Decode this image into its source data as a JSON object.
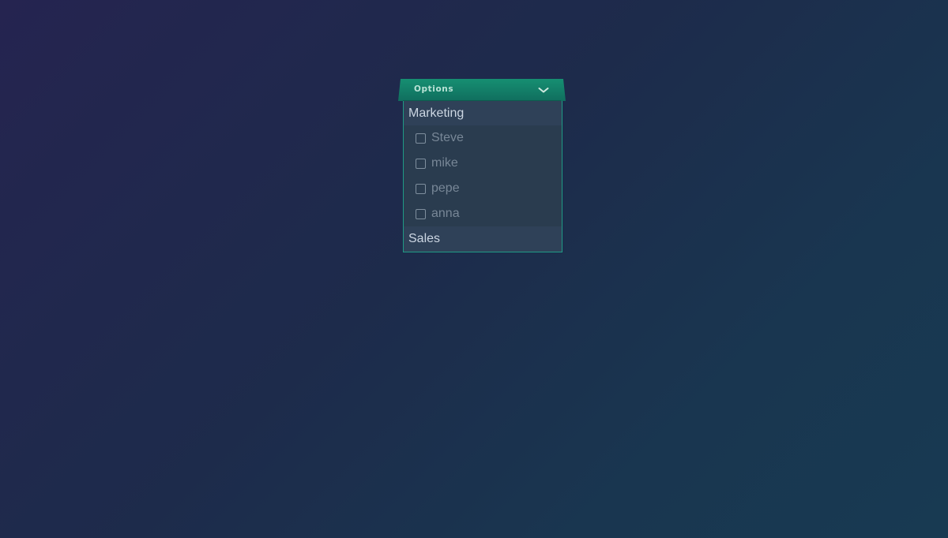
{
  "dropdown": {
    "title": "Options",
    "toggle_icon": "chevron-down-icon",
    "groups": [
      {
        "label": "Marketing",
        "items": [
          {
            "label": "Steve",
            "checked": false
          },
          {
            "label": "mike",
            "checked": false
          },
          {
            "label": "pepe",
            "checked": false
          },
          {
            "label": "anna",
            "checked": false
          }
        ]
      },
      {
        "label": "Sales",
        "items": []
      }
    ]
  },
  "colors": {
    "header_accent": "#138a6e",
    "panel_border": "#1f9a85",
    "panel_bg": "#2a3c4f",
    "group_header_bg": "#2f4158"
  }
}
